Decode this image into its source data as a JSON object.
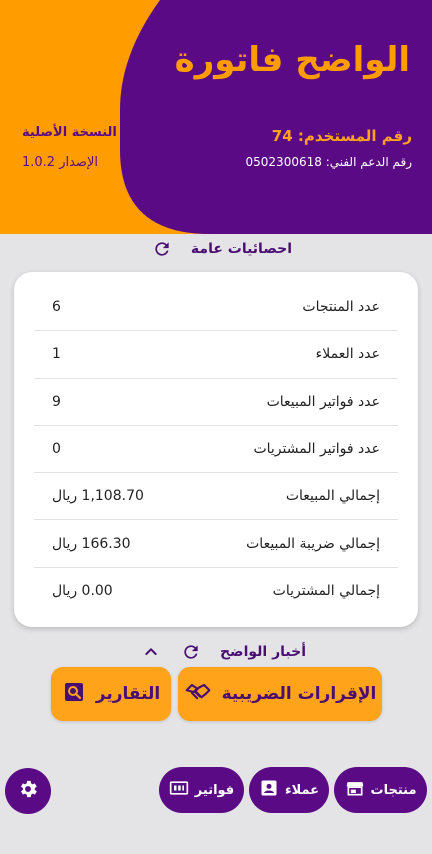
{
  "colors": {
    "purple": "#5b0a86",
    "orange": "#ff9c00",
    "background": "#e4e4e6"
  },
  "header": {
    "app_title": "الواضح فاتورة",
    "user_number": "رقم المستخدم: 74",
    "support_number": "رقم الدعم الفني: 0502300618",
    "edition": "النسخة الأصلية",
    "version": "الإصدار 1.0.2"
  },
  "stats": {
    "title": "احصائيات عامة",
    "refresh_icon": "refresh-icon",
    "rows": [
      {
        "label": "عدد المنتجات",
        "value": "6"
      },
      {
        "label": "عدد العملاء",
        "value": "1"
      },
      {
        "label": "عدد فواتير المبيعات",
        "value": "9"
      },
      {
        "label": "عدد فواتير المشتريات",
        "value": "0"
      },
      {
        "label": "إجمالي المبيعات",
        "value": "1,108.70 ريال"
      },
      {
        "label": "إجمالي ضريبة المبيعات",
        "value": "166.30 ريال"
      },
      {
        "label": "إجمالي المشتريات",
        "value": "0.00 ريال"
      }
    ]
  },
  "news": {
    "title": "أخبار الواضح",
    "refresh_icon": "refresh-icon",
    "toggle_icon": "chevron-up-icon"
  },
  "actions": {
    "tax_returns": {
      "label": "الإقرارات الضريبية",
      "icon": "handshake-icon"
    },
    "reports": {
      "label": "التقارير",
      "icon": "report-search-icon"
    }
  },
  "bottom_nav": {
    "products": {
      "label": "منتجات",
      "icon": "store-icon"
    },
    "customers": {
      "label": "عملاء",
      "icon": "contact-card-icon"
    },
    "invoices": {
      "label": "فواتير",
      "icon": "receipt-icon"
    },
    "settings": {
      "icon": "gear-icon"
    }
  }
}
